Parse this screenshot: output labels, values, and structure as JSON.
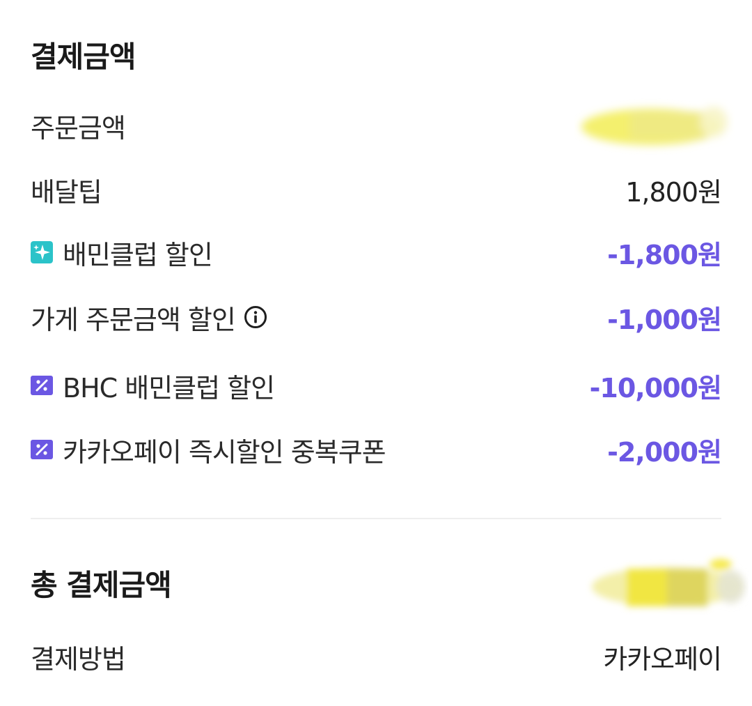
{
  "payment_section": {
    "title": "결제금액",
    "rows": [
      {
        "label": "주문금액",
        "value": "",
        "icon": "",
        "masked": true
      },
      {
        "label": "배달팁",
        "value": "1,800원",
        "icon": ""
      },
      {
        "label": "배민클럽 할인",
        "value": "-1,800원",
        "icon": "sparkle-icon"
      },
      {
        "label": "가게 주문금액 할인",
        "value": "-1,000원",
        "icon": "info-icon"
      },
      {
        "label": "BHC 배민클럽 할인",
        "value": "-10,000원",
        "icon": "coupon-icon"
      },
      {
        "label": "카카오페이 즉시할인 중복쿠폰",
        "value": "-2,000원",
        "icon": "coupon-icon"
      }
    ]
  },
  "total_section": {
    "title": "총 결제금액",
    "total_value": "",
    "total_masked": true,
    "method_label": "결제방법",
    "method_value": "카카오페이"
  },
  "colors": {
    "discount": "#6b57e3",
    "sparkle_bg": "#2bc3c9",
    "coupon_bg": "#6b57e3",
    "mask_yellow": "#f4f06a"
  }
}
